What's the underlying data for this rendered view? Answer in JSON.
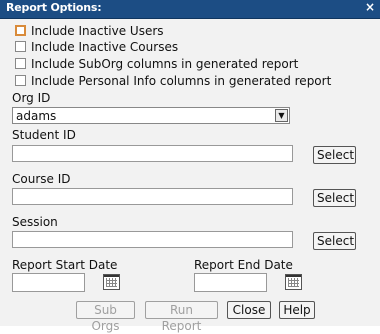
{
  "dialog": {
    "title": "Report Options:",
    "close_symbol": "×"
  },
  "options": [
    {
      "label": "Include Inactive Users",
      "checked": false
    },
    {
      "label": "Include Inactive Courses",
      "checked": false
    },
    {
      "label": "Include SubOrg columns in generated report",
      "checked": false
    },
    {
      "label": "Include Personal Info columns in generated report",
      "checked": false
    }
  ],
  "org": {
    "label": "Org ID",
    "value": "adams"
  },
  "student": {
    "label": "Student ID",
    "value": "",
    "select_label": "Select"
  },
  "course": {
    "label": "Course ID",
    "value": "",
    "select_label": "Select"
  },
  "session": {
    "label": "Session",
    "value": "",
    "select_label": "Select"
  },
  "dates": {
    "start_label": "Report Start Date",
    "end_label": "Report End Date",
    "start_value": "",
    "end_value": ""
  },
  "actions": {
    "sub_orgs": "Sub Orgs",
    "run_report": "Run Report",
    "close": "Close",
    "help": "Help"
  },
  "icons": {
    "dropdown": "chevron-down-icon",
    "calendar": "calendar-icon"
  },
  "colors": {
    "titlebar": "#1c4d84",
    "focus": "#d98b3a"
  }
}
